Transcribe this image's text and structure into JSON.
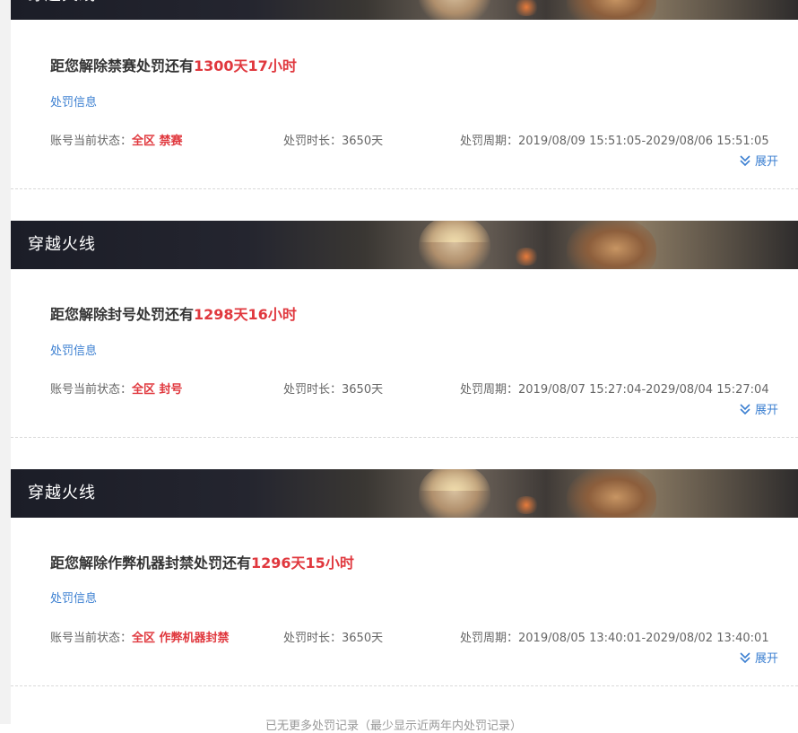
{
  "game_title": "穿越火线",
  "info_link_label": "处罚信息",
  "expand_label": "展开",
  "labels": {
    "status": "账号当前状态：",
    "duration": "处罚时长：",
    "period": "处罚周期："
  },
  "records": [
    {
      "headline_prefix": "距您解除禁赛处罚还有",
      "remaining": "1300天17小时",
      "status_value": "全区 禁赛",
      "duration_value": "3650天",
      "period_value": "2019/08/09 15:51:05-2029/08/06 15:51:05"
    },
    {
      "headline_prefix": "距您解除封号处罚还有",
      "remaining": "1298天16小时",
      "status_value": "全区 封号",
      "duration_value": "3650天",
      "period_value": "2019/08/07 15:27:04-2029/08/04 15:27:04"
    },
    {
      "headline_prefix": "距您解除作弊机器封禁处罚还有",
      "remaining": "1296天15小时",
      "status_value": "全区 作弊机器封禁",
      "duration_value": "3650天",
      "period_value": "2019/08/05 13:40:01-2029/08/02 13:40:01"
    }
  ],
  "footer_note": "已无更多处罚记录（最少显示近两年内处罚记录）"
}
